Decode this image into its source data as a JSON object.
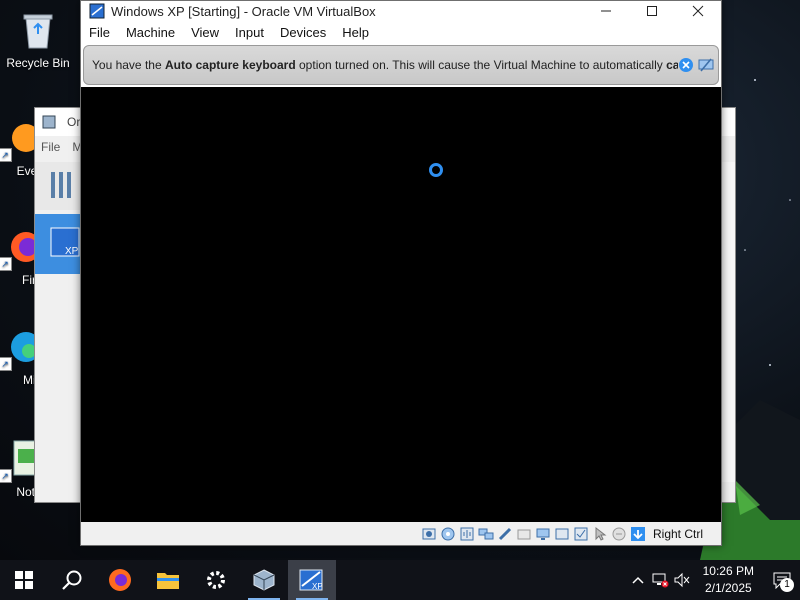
{
  "desktop": {
    "icons": [
      {
        "label": "Recycle Bin"
      },
      {
        "label": "Ever"
      },
      {
        "label": "Fir"
      },
      {
        "label": "Micr E"
      },
      {
        "label": "Note"
      }
    ]
  },
  "manager_window": {
    "title": "Ora",
    "menu": [
      "File",
      "M"
    ]
  },
  "vm_window": {
    "title": "Windows XP [Starting] - Oracle VM VirtualBox",
    "menu": [
      "File",
      "Machine",
      "View",
      "Input",
      "Devices",
      "Help"
    ],
    "notice": {
      "prefix": "You have the ",
      "bold1": "Auto capture keyboard",
      "middle": " option turned on. This will cause the Virtual Machine to automatically ",
      "bold2": "capture"
    },
    "status": {
      "host_key": "Right Ctrl"
    }
  },
  "taskbar": {
    "apps": [
      "start",
      "search",
      "firefox",
      "file-explorer",
      "settings",
      "virtualbox",
      "windows-xp-vm"
    ],
    "clock_time": "10:26 PM",
    "clock_date": "2/1/2025",
    "notification_count": "1"
  },
  "colors": {
    "accent": "#2f8ff0",
    "taskbar": "#101218",
    "vm_screen": "#000000"
  }
}
